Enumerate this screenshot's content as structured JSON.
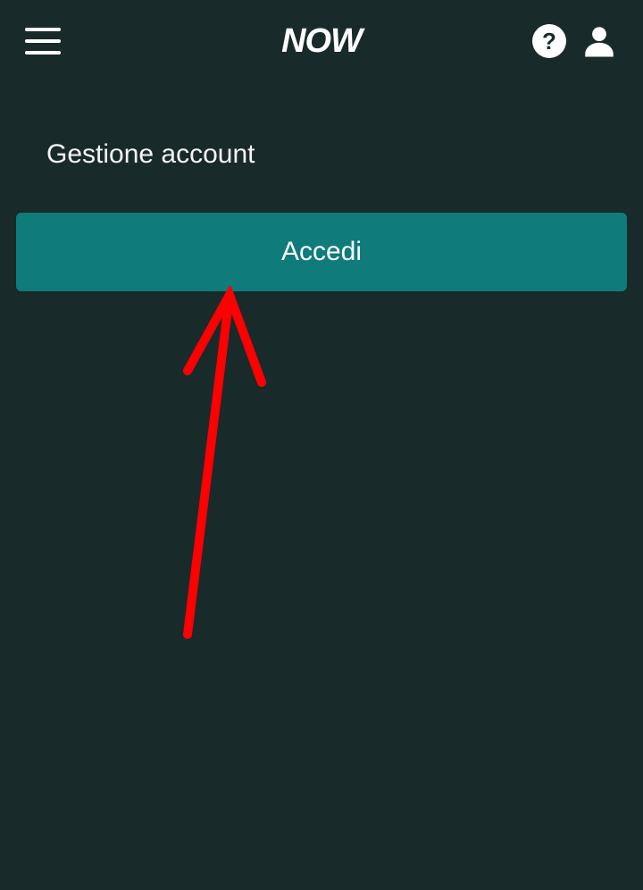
{
  "header": {
    "logo_text": "NOW"
  },
  "page": {
    "title": "Gestione account"
  },
  "actions": {
    "login_label": "Accedi"
  }
}
